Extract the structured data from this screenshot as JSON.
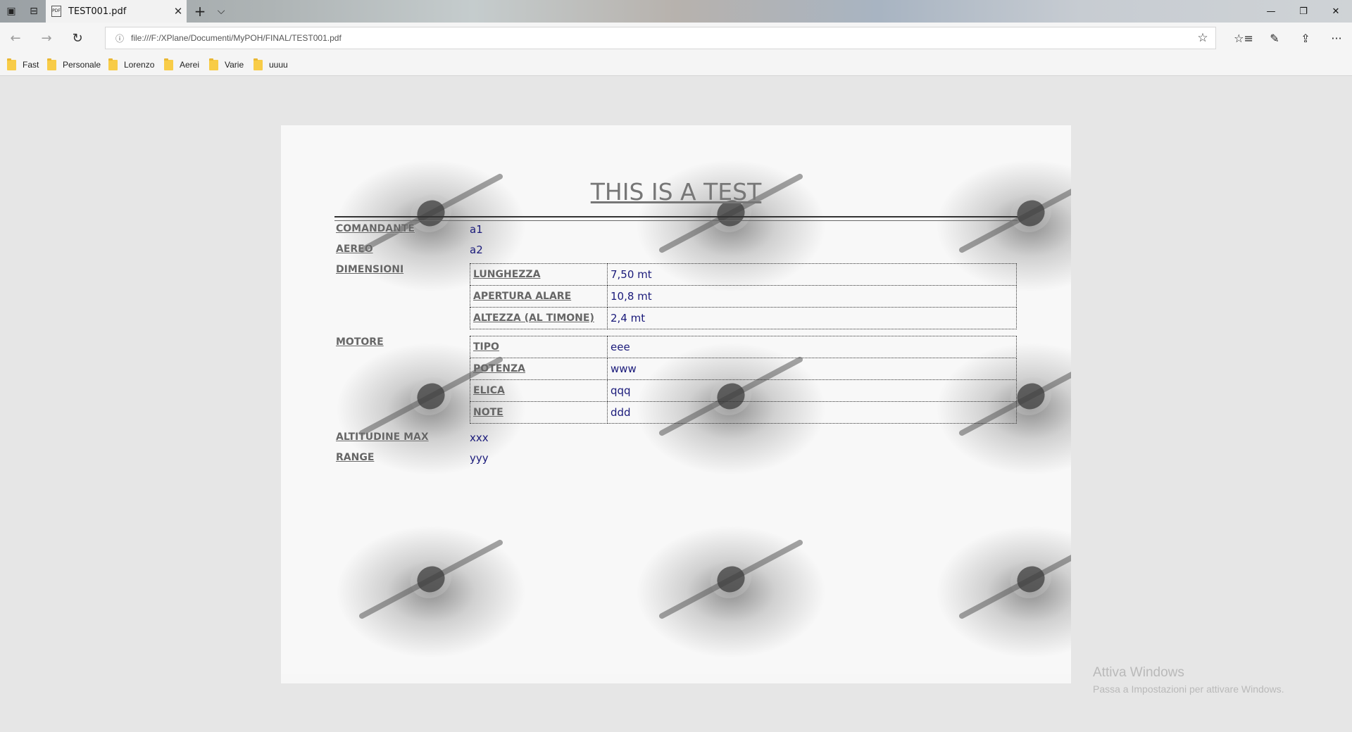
{
  "titlebar": {
    "tab_title": "TEST001.pdf",
    "tab_icon": "pdf-file-icon",
    "new_tab": "+",
    "tab_list": "⌵",
    "close": "✕",
    "minimize": "—",
    "restore": "❐",
    "window_close": "✕"
  },
  "nav": {
    "back": "←",
    "forward": "→",
    "refresh": "↻",
    "url": "file:///F:/XPlane/Documenti/MyPOH/FINAL/TEST001.pdf",
    "info": "ⓘ",
    "favorite": "☆",
    "favorites_hub": "☆≡",
    "notes": "✎",
    "share": "⇪",
    "more": "···"
  },
  "favorites": [
    "Fast",
    "Personale",
    "Lorenzo",
    "Aerei",
    "Varie",
    "uuuu"
  ],
  "document": {
    "title": "THIS IS A TEST",
    "comandante_label": "COMANDANTE",
    "comandante_value": "a1",
    "aereo_label": "AEREO",
    "aereo_value": "a2",
    "dimensioni_label": "DIMENSIONI",
    "dimensioni": [
      {
        "k": "LUNGHEZZA",
        "v": "7,50 mt"
      },
      {
        "k": "APERTURA ALARE",
        "v": "10,8 mt"
      },
      {
        "k": "ALTEZZA (AL TIMONE)",
        "v": "2,4 mt"
      }
    ],
    "motore_label": "MOTORE",
    "motore": [
      {
        "k": "TIPO",
        "v": "eee"
      },
      {
        "k": "POTENZA",
        "v": "www"
      },
      {
        "k": "ELICA",
        "v": "qqq"
      },
      {
        "k": "NOTE",
        "v": "ddd"
      }
    ],
    "altitudine_label": "ALTITUDINE MAX",
    "altitudine_value": "xxx",
    "range_label": "RANGE",
    "range_value": "yyy"
  },
  "watermark": {
    "line1": "Attiva Windows",
    "line2": "Passa a Impostazioni per attivare Windows."
  }
}
